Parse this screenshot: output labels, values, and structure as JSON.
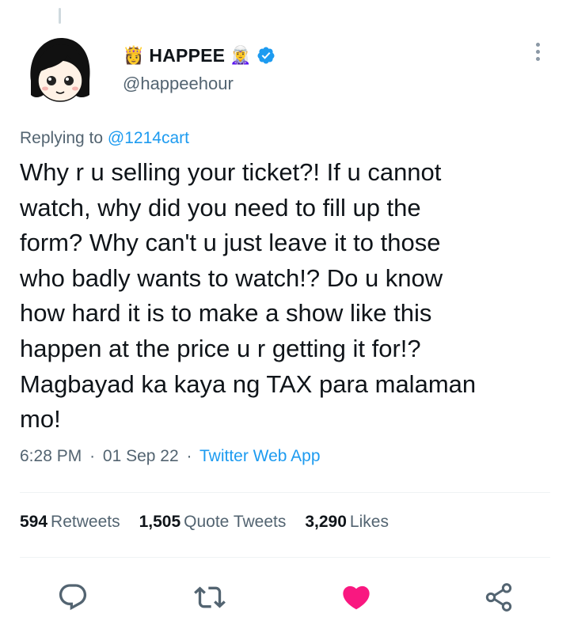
{
  "profile": {
    "display_name": "HAPPEE",
    "handle": "@happeehour",
    "prefix_emoji": "👸",
    "suffix_emoji": "🧝‍♀️",
    "verified_icon": "verified-badge-icon",
    "avatar_icon": "cartoon-girl-avatar"
  },
  "reply": {
    "prefix": "Replying to",
    "to": "@1214cart"
  },
  "tweet": {
    "text": "Why r u selling your ticket?! If u cannot\nwatch, why did you need to fill up the\nform? Why can't u just leave it to those\nwho badly wants to watch!? Do u know\nhow hard it is to make a show like this\nhappen at the price u r getting it for!?\nMagbayad ka kaya ng TAX para malaman\nmo!"
  },
  "meta": {
    "time": "6:28 PM",
    "sep1": "·",
    "date": "01 Sep 22",
    "sep2": "·",
    "source": "Twitter Web App"
  },
  "stats": {
    "retweets_count": "594",
    "retweets_label": "Retweets",
    "quotes_count": "1,505",
    "quotes_label": "Quote Tweets",
    "likes_count": "3,290",
    "likes_label": "Likes"
  },
  "actions": {
    "reply_icon": "reply-icon",
    "retweet_icon": "retweet-icon",
    "like_icon": "heart-icon",
    "share_icon": "share-icon"
  },
  "colors": {
    "accent": "#1d9bf0",
    "like": "#f91880",
    "text": "#0f1419",
    "secondary": "#536471"
  }
}
